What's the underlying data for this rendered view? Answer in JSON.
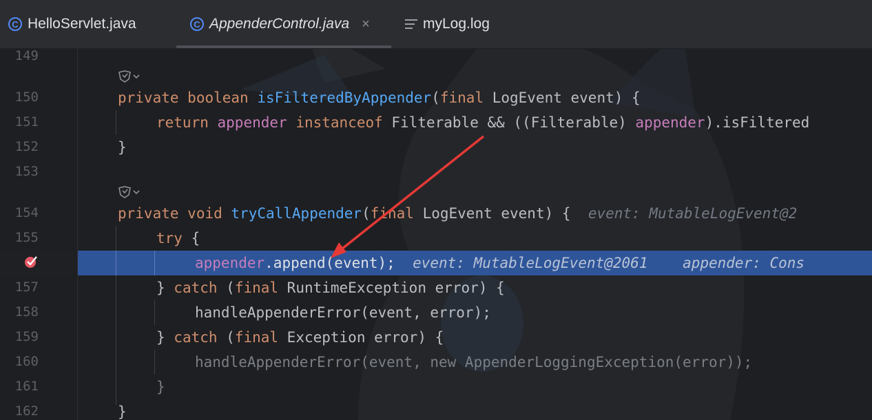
{
  "tabs": [
    {
      "label": "HelloServlet.java",
      "icon": "class-icon",
      "active": false
    },
    {
      "label": "AppenderControl.java",
      "icon": "class-icon",
      "active": true
    },
    {
      "label": "myLog.log",
      "icon": "log-file-icon",
      "active": false
    }
  ],
  "tab_class_glyph": "C",
  "close_glyph": "×",
  "gutter": {
    "line_numbers": [
      "149",
      "150",
      "151",
      "152",
      "153",
      "154",
      "155",
      "157",
      "158",
      "159",
      "160",
      "161",
      "162"
    ],
    "breakpoint_icon": "breakpoint-check-icon"
  },
  "code": {
    "l150": {
      "kw1": "private",
      "kw2": "boolean",
      "fn": "isFilteredByAppender",
      "p1": "(",
      "kw3": "final",
      "rest": " LogEvent event) {"
    },
    "l151": {
      "kw1": "return",
      "fld1": "appender",
      "kw2": "instanceof",
      "mid": " Filterable && ((Filterable) ",
      "fld2": "appender",
      "rest": ").isFiltered"
    },
    "l152": "}",
    "l154": {
      "kw1": "private",
      "kw2": "void",
      "fn": "tryCallAppender",
      "p1": "(",
      "kw3": "final",
      "rest": " LogEvent event) {",
      "hint": "event: MutableLogEvent@2"
    },
    "l155": {
      "kw": "try",
      "rest": " {"
    },
    "l156": {
      "fld": "appender",
      "rest": ".append(event);",
      "hint1": "event: MutableLogEvent@2061",
      "hint2": "appender: Cons"
    },
    "l157": {
      "p1": "} ",
      "kw1": "catch",
      "p2": " (",
      "kw2": "final",
      "rest": " RuntimeException error) {"
    },
    "l158": "handleAppenderError(event, error);",
    "l159": {
      "p1": "} ",
      "kw1": "catch",
      "p2": " (",
      "kw2": "final",
      "rest": " Exception error) {"
    },
    "l160": "handleAppenderError(event, new AppenderLoggingException(error));",
    "l161": "}",
    "l162": "}"
  },
  "code_lens_icon": "code-lens-icon",
  "colors": {
    "keyword": "#cf8e6d",
    "function": "#56a8f5",
    "field": "#c77dbb",
    "execution_line": "#2f5599",
    "annotation_arrow": "#e53935"
  }
}
